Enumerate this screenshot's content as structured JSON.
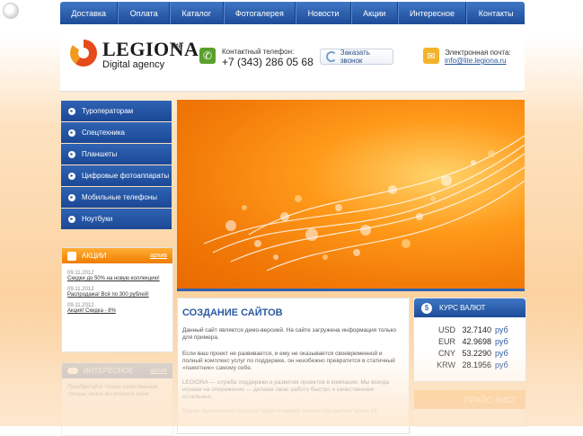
{
  "nav": {
    "items": [
      "Доставка",
      "Оплата",
      "Каталог",
      "Фотогалерея",
      "Новости",
      "Акции",
      "Интересное",
      "Контакты"
    ]
  },
  "header": {
    "logo_text": "LEGIONA",
    "logo_sup": "lite",
    "logo_sub": "Digital agency",
    "phone_label": "Контактный телефон:",
    "phone_number": "+7 (343) 286 05 68",
    "callback_label": "Заказать звонок",
    "email_label": "Электронная почта:",
    "email": "info@lite.legiona.ru"
  },
  "sidebar": {
    "items": [
      "Туроператорам",
      "Спецтехника",
      "Планшеты",
      "Цифровые фотоаппараты",
      "Мобильные телефоны",
      "Ноутбуки"
    ]
  },
  "promos": {
    "title": "АКЦИИ",
    "archive": "архив",
    "items": [
      {
        "date": "09.11.2012",
        "text": "Скидки до 50% на новую коллекцию!"
      },
      {
        "date": "09.11.2012",
        "text": "Распродажа! Всё по 300 рублей!"
      },
      {
        "date": "09.11.2012",
        "text": "Акция! Скидка - 8%"
      }
    ]
  },
  "interesting": {
    "title": "ИНТЕРЕСНОЕ",
    "archive": "архив",
    "text": "Приобретайте только качественные товары, иначе вы рискуете всем"
  },
  "content": {
    "title": "СОЗДАНИЕ САЙТОВ",
    "p1": "Данный сайт является демо-версией. На сайте загружена информация только для примера.",
    "p2": "Если ваш проект не развивается, и ему не оказывается своевременной и полный комплекс услуг по поддержке, он неизбежно превратится в статичный «памятник» самому себе.",
    "p3": "LEGIONA — служба поддержки и развития проектов в компании. Мы всегда играем на опережение — делаем свою работу быстро и качественнее остальных.",
    "p4": "Время выполнения простых задач «первой линии» составляет всего 15"
  },
  "rates": {
    "title": "КУРС ВАЛЮТ",
    "unit": "руб",
    "rows": [
      {
        "code": "USD",
        "value": "32.7140"
      },
      {
        "code": "EUR",
        "value": "42.9698"
      },
      {
        "code": "CNY",
        "value": "53.2290"
      },
      {
        "code": "KRW",
        "value": "28.1956"
      }
    ]
  },
  "price_list": {
    "title": "ПРАЙС-ЛИСТ"
  },
  "colors": {
    "nav_blue": "#1d4c98",
    "accent_orange": "#f07d00",
    "link_blue": "#2b5aa0"
  }
}
